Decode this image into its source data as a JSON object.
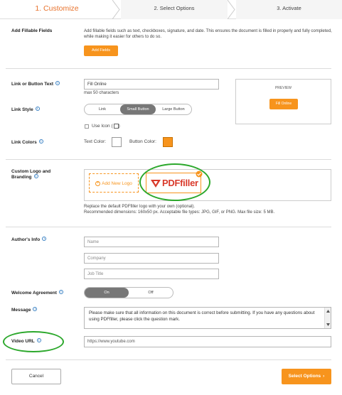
{
  "steps": [
    {
      "label": "1. Customize"
    },
    {
      "label": "2. Select Options"
    },
    {
      "label": "3. Activate"
    }
  ],
  "fillable": {
    "label": "Add Fillable Fields",
    "description": "Add fillable fields such as text, checkboxes, signature, and date. This ensures the document is filled in properly and fully completed, while making it easier for others to do so.",
    "button": "Add Fields"
  },
  "link_text": {
    "label": "Link or Button Text",
    "value": "Fill Online",
    "hint": "max 50 characters"
  },
  "preview": {
    "title": "PREVIEW",
    "button": "Fill Online"
  },
  "link_style": {
    "label": "Link Style",
    "options": [
      "Link",
      "Small Button",
      "Large Button"
    ],
    "selected": "Small Button",
    "use_icon": "Use Icon ("
  },
  "link_colors": {
    "label": "Link Colors",
    "text_color_label": "Text Color:",
    "button_color_label": "Button Color:",
    "text_color": "#ffffff",
    "button_color": "#f7941d"
  },
  "logo": {
    "label": "Custom Logo and Branding",
    "add_new": "Add New Logo",
    "brand": "PDFfiller",
    "note1": "Replace the default PDFfiller logo with your own (optional).",
    "note2": "Recommended dimensions: 160x50 px. Acceptable file types: JPG, GIF, or PNG. Max file size: 5 MB."
  },
  "author": {
    "label": "Author's Info",
    "name_placeholder": "Name",
    "company_placeholder": "Company",
    "job_placeholder": "Job Title"
  },
  "welcome": {
    "label": "Welcome Agreement",
    "on": "On",
    "off": "Off"
  },
  "message": {
    "label": "Message",
    "text": "Please make sure that all information on this document is correct before submitting. If you have any questions about using PDFfiller, please click the question mark."
  },
  "video": {
    "label": "Video URL",
    "value": "https://www.youtube.com"
  },
  "footer": {
    "cancel": "Cancel",
    "next": "Select Options"
  },
  "colors": {
    "accent": "#f7941d",
    "highlight": "#2ca82c"
  }
}
